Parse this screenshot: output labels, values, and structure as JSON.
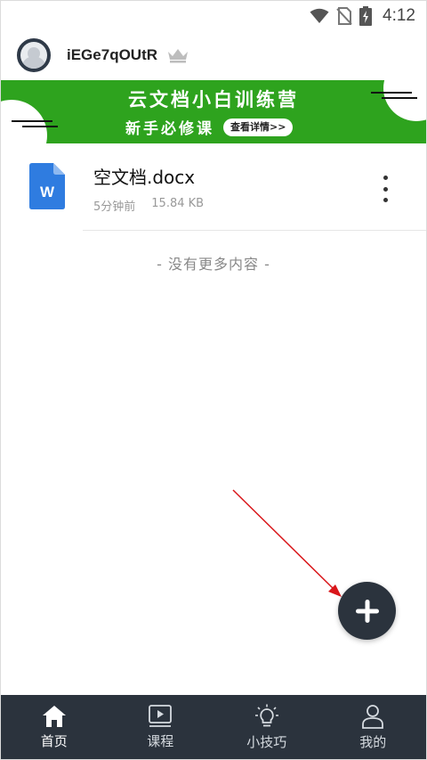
{
  "status": {
    "time": "4:12"
  },
  "header": {
    "username": "iEGe7qOUtR"
  },
  "banner": {
    "title": "云文档小白训练营",
    "subtitle": "新手必修课",
    "button_label": "查看详情>>"
  },
  "files": [
    {
      "name": "空文档.docx",
      "modified": "5分钟前",
      "size": "15.84 KB",
      "icon": "word-doc-icon"
    }
  ],
  "list_footer": "- 没有更多内容 -",
  "nav": {
    "items": [
      {
        "label": "首页",
        "icon": "home-icon",
        "active": true
      },
      {
        "label": "课程",
        "icon": "video-play-icon",
        "active": false
      },
      {
        "label": "小技巧",
        "icon": "lightbulb-icon",
        "active": false
      },
      {
        "label": "我的",
        "icon": "user-icon",
        "active": false
      }
    ]
  },
  "colors": {
    "banner_green": "#2ea31e",
    "nav_bg": "#2b333d",
    "fab_bg": "#2b333d",
    "word_blue": "#2f7ce0",
    "annotation_red": "#d9161a"
  }
}
